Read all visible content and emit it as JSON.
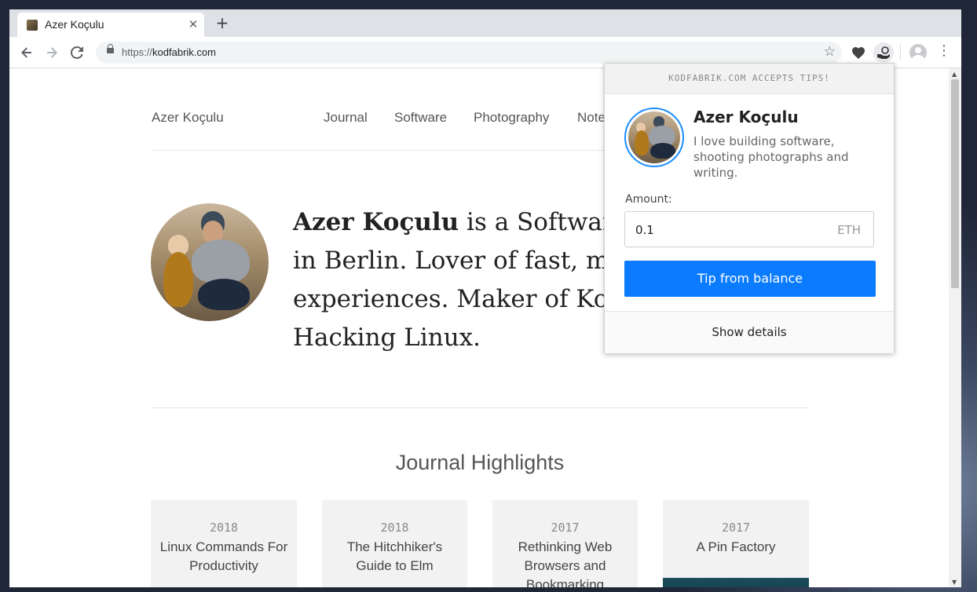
{
  "browser": {
    "tab_title": "Azer Koçulu",
    "tab_close": "✕",
    "new_tab": "+",
    "url_scheme": "https://",
    "url_host": "kodfabrik.com"
  },
  "site": {
    "name": "Azer Koçulu",
    "nav": [
      "Journal",
      "Software",
      "Photography",
      "Note"
    ],
    "hero": {
      "bold": "Azer Koçulu",
      "line1": " is a Software E",
      "line2": "in Berlin. Lover of fast, mir",
      "line3": "experiences. Maker of Kozm",
      "line4": "Hacking Linux."
    },
    "highlights_title": "Journal Highlights",
    "cards": [
      {
        "year": "2018",
        "title": "Linux Commands For Productivity"
      },
      {
        "year": "2018",
        "title": "The Hitchhiker's Guide to Elm"
      },
      {
        "year": "2017",
        "title": "Rethinking Web Browsers and Bookmarking"
      },
      {
        "year": "2017",
        "title": "A Pin Factory"
      }
    ]
  },
  "popup": {
    "header": "KODFABRIK.COM ACCEPTS TIPS!",
    "name": "Azer Koçulu",
    "bio": "I love building software, shooting photographs and writing.",
    "amount_label": "Amount:",
    "amount_value": "0.1",
    "amount_unit": "ETH",
    "tip_button": "Tip from balance",
    "footer": "Show details"
  },
  "colors": {
    "accent": "#0b7bff",
    "avatar_ring": "#1a8cff"
  }
}
